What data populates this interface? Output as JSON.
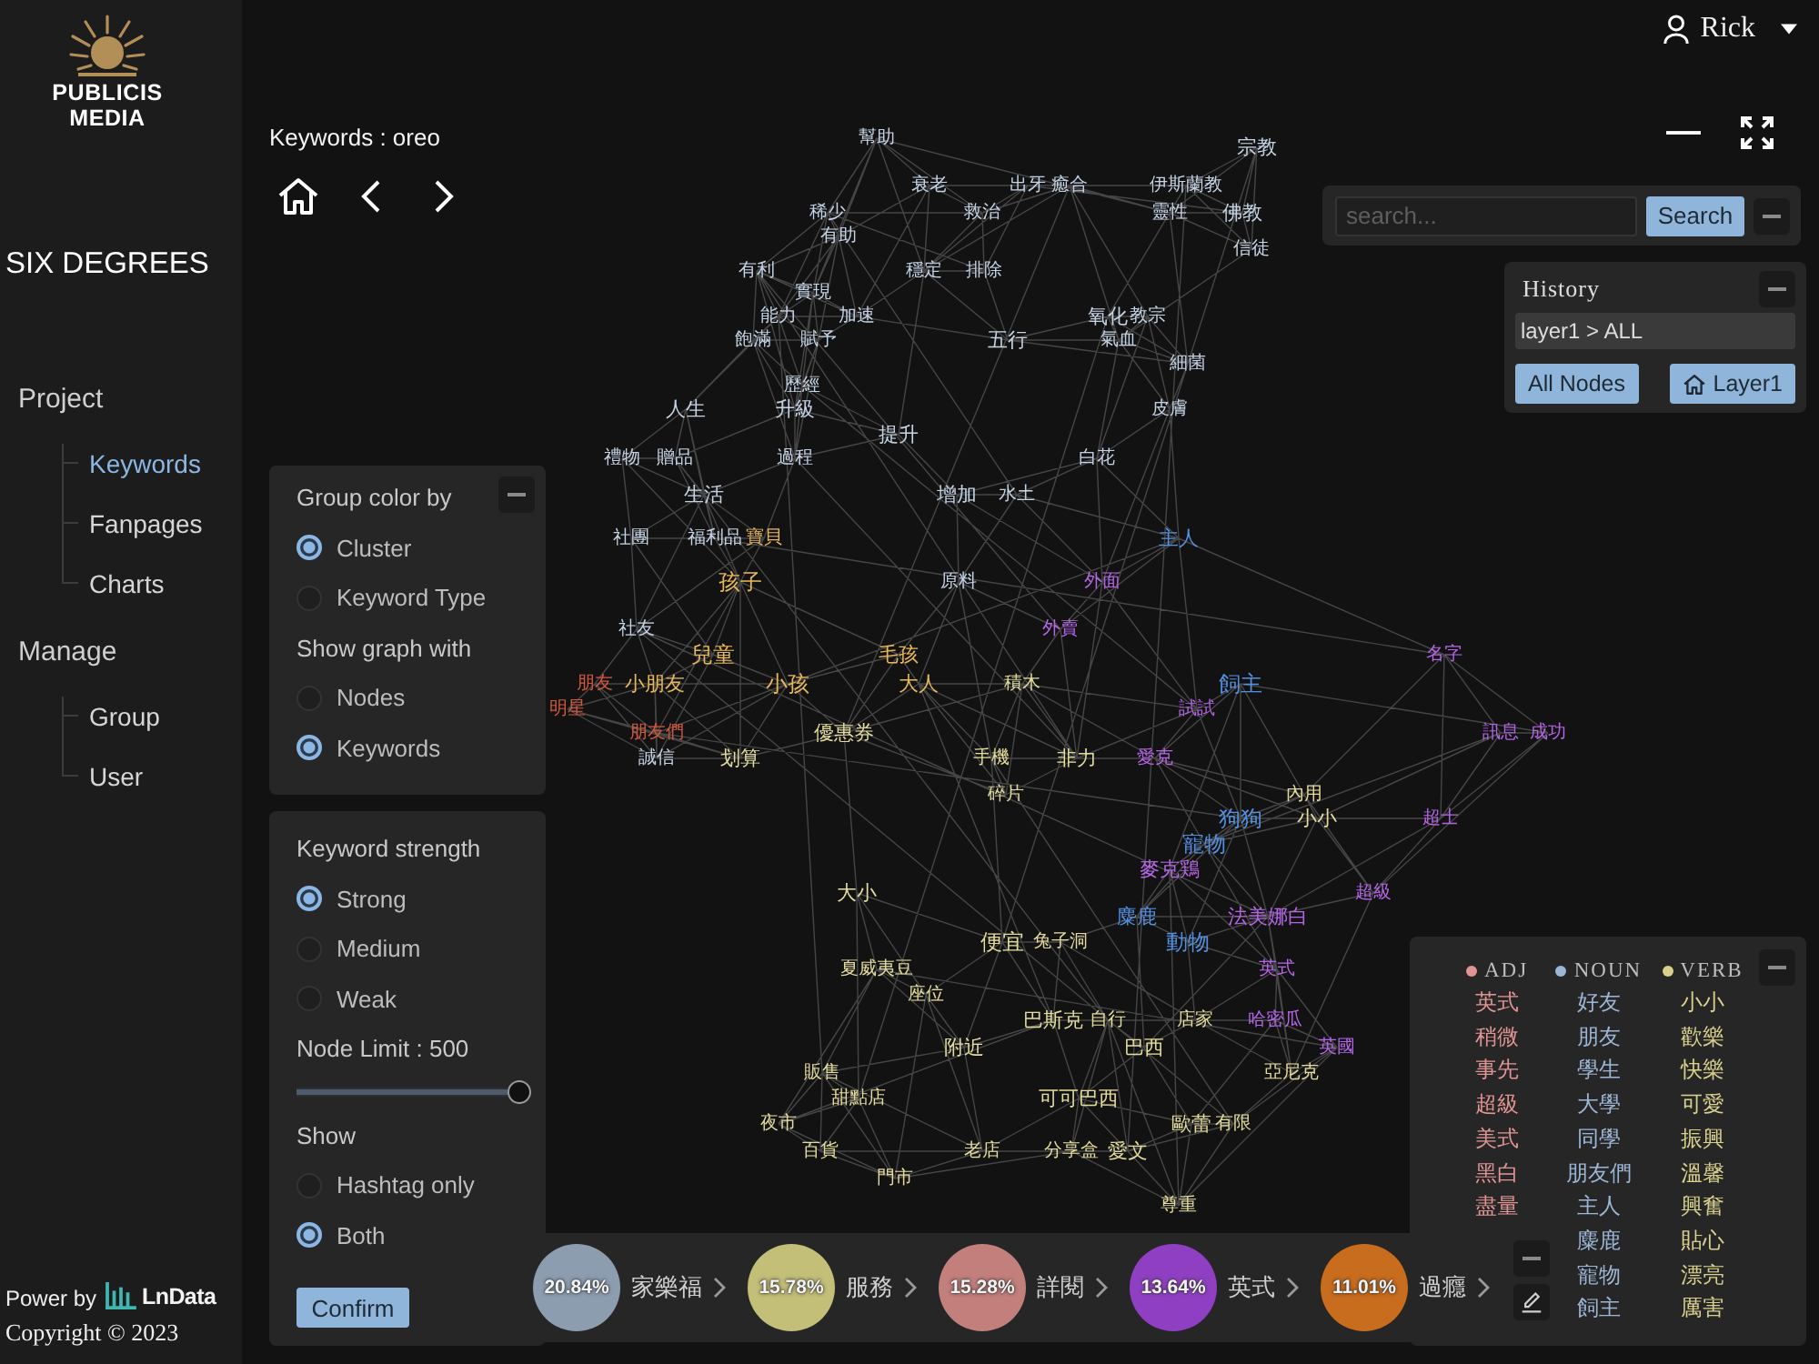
{
  "sidebar": {
    "logo_text": [
      "PUBLICIS",
      "MEDIA"
    ],
    "app_title": "SIX DEGREES",
    "sections": [
      {
        "label": "Project",
        "items": [
          {
            "label": "Keywords",
            "selected": true
          },
          {
            "label": "Fanpages",
            "selected": false
          },
          {
            "label": "Charts",
            "selected": false
          }
        ]
      },
      {
        "label": "Manage",
        "items": [
          {
            "label": "Group",
            "selected": false
          },
          {
            "label": "User",
            "selected": false
          }
        ]
      }
    ],
    "powered_by": "Power by",
    "partner_logo": "LnData",
    "copyright": "Copyright © 2023"
  },
  "header": {
    "user": "Rick"
  },
  "breadcrumb": "Keywords : oreo",
  "search": {
    "placeholder": "search...",
    "button": "Search"
  },
  "history": {
    "title": "History",
    "path": "layer1 > ALL",
    "buttons": [
      {
        "label": "All Nodes",
        "kind": "plain"
      },
      {
        "label": "Layer1",
        "kind": "home"
      }
    ]
  },
  "display_panel": {
    "groups": [
      {
        "title": "Group color by",
        "options": [
          {
            "label": "Cluster",
            "selected": true
          },
          {
            "label": "Keyword Type",
            "selected": false
          }
        ]
      },
      {
        "title": "Show graph with",
        "options": [
          {
            "label": "Nodes",
            "selected": false
          },
          {
            "label": "Keywords",
            "selected": true
          }
        ]
      }
    ]
  },
  "filter_panel": {
    "strength": {
      "title": "Keyword strength",
      "options": [
        {
          "label": "Strong",
          "selected": true
        },
        {
          "label": "Medium",
          "selected": false
        },
        {
          "label": "Weak",
          "selected": false
        }
      ]
    },
    "node_limit": {
      "label": "Node Limit : 500",
      "level": 1
    },
    "show": {
      "title": "Show",
      "options": [
        {
          "label": "Hashtag only",
          "selected": false
        },
        {
          "label": "Both",
          "selected": true
        }
      ]
    },
    "button": "Confirm"
  },
  "graph": {
    "nodes": [
      {
        "label": "幫助",
        "color": "#c4d3e4"
      },
      {
        "label": "宗教",
        "color": "#c4d3e4"
      },
      {
        "label": "衰老",
        "color": "#c4d3e4"
      },
      {
        "label": "出牙",
        "color": "#c4d3e4"
      },
      {
        "label": "癒合",
        "color": "#c4d3e4"
      },
      {
        "label": "伊斯蘭教",
        "color": "#c4d3e4"
      },
      {
        "label": "稀少",
        "color": "#c4d3e4"
      },
      {
        "label": "救治",
        "color": "#c4d3e4"
      },
      {
        "label": "靈性",
        "color": "#c4d3e4"
      },
      {
        "label": "佛教",
        "color": "#c4d3e4"
      },
      {
        "label": "有助",
        "color": "#c4d3e4"
      },
      {
        "label": "信徒",
        "color": "#c4d3e4"
      },
      {
        "label": "有利",
        "color": "#c4d3e4"
      },
      {
        "label": "穩定",
        "color": "#c4d3e4"
      },
      {
        "label": "排除",
        "color": "#c4d3e4"
      },
      {
        "label": "實現",
        "color": "#c4d3e4"
      },
      {
        "label": "能力",
        "color": "#c4d3e4"
      },
      {
        "label": "加速",
        "color": "#c4d3e4"
      },
      {
        "label": "氧化",
        "color": "#c4d3e4"
      },
      {
        "label": "教宗",
        "color": "#c4d3e4"
      },
      {
        "label": "飽滿",
        "color": "#c4d3e4"
      },
      {
        "label": "賦予",
        "color": "#c4d3e4"
      },
      {
        "label": "五行",
        "color": "#c4d3e4"
      },
      {
        "label": "氣血",
        "color": "#c4d3e4"
      },
      {
        "label": "細菌",
        "color": "#c4d3e4"
      },
      {
        "label": "歷經",
        "color": "#c4d3e4"
      },
      {
        "label": "人生",
        "color": "#c4d3e4"
      },
      {
        "label": "升級",
        "color": "#c4d3e4"
      },
      {
        "label": "皮膚",
        "color": "#c4d3e4"
      },
      {
        "label": "提升",
        "color": "#c4d3e4"
      },
      {
        "label": "禮物",
        "color": "#c4d3e4"
      },
      {
        "label": "贈品",
        "color": "#c4d3e4"
      },
      {
        "label": "過程",
        "color": "#c4d3e4"
      },
      {
        "label": "白花",
        "color": "#c4d3e4"
      },
      {
        "label": "生活",
        "color": "#c4d3e4"
      },
      {
        "label": "增加",
        "color": "#c4d3e4"
      },
      {
        "label": "水土",
        "color": "#c4d3e4"
      },
      {
        "label": "社團",
        "color": "#c4d3e4"
      },
      {
        "label": "福利品",
        "color": "#c4d3e4"
      },
      {
        "label": "寶貝",
        "color": "#e6b85a"
      },
      {
        "label": "主人",
        "color": "#5590e0"
      },
      {
        "label": "孩子",
        "color": "#e6b85a"
      },
      {
        "label": "原料",
        "color": "#c4d3e4"
      },
      {
        "label": "外面",
        "color": "#b466e6"
      },
      {
        "label": "社友",
        "color": "#c4d3e4"
      },
      {
        "label": "外賣",
        "color": "#b466e6"
      },
      {
        "label": "兒童",
        "color": "#e6b85a"
      },
      {
        "label": "毛孩",
        "color": "#e6b85a"
      },
      {
        "label": "名字",
        "color": "#b466e6"
      },
      {
        "label": "朋友",
        "color": "#d2583f"
      },
      {
        "label": "小朋友",
        "color": "#e6b85a"
      },
      {
        "label": "小孩",
        "color": "#e6b85a"
      },
      {
        "label": "大人",
        "color": "#e6b85a"
      },
      {
        "label": "積木",
        "color": "#e3dc9c"
      },
      {
        "label": "飼主",
        "color": "#5590e0"
      },
      {
        "label": "明星",
        "color": "#d2583f"
      },
      {
        "label": "試試",
        "color": "#b466e6"
      },
      {
        "label": "朋友們",
        "color": "#d2583f"
      },
      {
        "label": "優惠券",
        "color": "#e3dc9c"
      },
      {
        "label": "訊息",
        "color": "#b466e6"
      },
      {
        "label": "成功",
        "color": "#b466e6"
      },
      {
        "label": "誠信",
        "color": "#c4d3e4"
      },
      {
        "label": "划算",
        "color": "#e3dc9c"
      },
      {
        "label": "手機",
        "color": "#e3dc9c"
      },
      {
        "label": "非力",
        "color": "#e3dc9c"
      },
      {
        "label": "愛克",
        "color": "#b466e6"
      },
      {
        "label": "碎片",
        "color": "#e3dc9c"
      },
      {
        "label": "內用",
        "color": "#e3dc9c"
      },
      {
        "label": "狗狗",
        "color": "#5590e0"
      },
      {
        "label": "小小",
        "color": "#e3dc9c"
      },
      {
        "label": "超士",
        "color": "#b466e6"
      },
      {
        "label": "寵物",
        "color": "#5590e0"
      },
      {
        "label": "麥克鶏",
        "color": "#b466e6"
      },
      {
        "label": "大小",
        "color": "#e3dc9c"
      },
      {
        "label": "超級",
        "color": "#b466e6"
      },
      {
        "label": "麋鹿",
        "color": "#5590e0"
      },
      {
        "label": "法美娜白",
        "color": "#b466e6"
      },
      {
        "label": "便宜",
        "color": "#e3dc9c"
      },
      {
        "label": "兔子洞",
        "color": "#e3dc9c"
      },
      {
        "label": "動物",
        "color": "#5590e0"
      },
      {
        "label": "夏威夷豆",
        "color": "#e3dc9c"
      },
      {
        "label": "英式",
        "color": "#b466e6"
      },
      {
        "label": "座位",
        "color": "#e3dc9c"
      },
      {
        "label": "巴斯克",
        "color": "#e3dc9c"
      },
      {
        "label": "自行",
        "color": "#e3dc9c"
      },
      {
        "label": "店家",
        "color": "#e3dc9c"
      },
      {
        "label": "哈密瓜",
        "color": "#b466e6"
      },
      {
        "label": "附近",
        "color": "#e3dc9c"
      },
      {
        "label": "巴西",
        "color": "#e3dc9c"
      },
      {
        "label": "英國",
        "color": "#b466e6"
      },
      {
        "label": "販售",
        "color": "#e3dc9c"
      },
      {
        "label": "亞尼克",
        "color": "#e3dc9c"
      },
      {
        "label": "甜點店",
        "color": "#e3dc9c"
      },
      {
        "label": "可可巴西",
        "color": "#e3dc9c"
      },
      {
        "label": "夜市",
        "color": "#e3dc9c"
      },
      {
        "label": "歐蕾",
        "color": "#e3dc9c"
      },
      {
        "label": "有限",
        "color": "#e3dc9c"
      },
      {
        "label": "百貨",
        "color": "#e3dc9c"
      },
      {
        "label": "老店",
        "color": "#e3dc9c"
      },
      {
        "label": "分享盒",
        "color": "#e3dc9c"
      },
      {
        "label": "愛文",
        "color": "#e3dc9c"
      },
      {
        "label": "門市",
        "color": "#e3dc9c"
      },
      {
        "label": "尊重",
        "color": "#e3dc9c"
      }
    ]
  },
  "legend": {
    "columns": [
      {
        "title": "ADJ",
        "color": "#e09494",
        "words": [
          "英式",
          "稍微",
          "事先",
          "超級",
          "美式",
          "黑白",
          "盡量"
        ]
      },
      {
        "title": "NOUN",
        "color": "#9db6d6",
        "words": [
          "好友",
          "朋友",
          "學生",
          "大學",
          "同學",
          "朋友們",
          "主人",
          "麋鹿",
          "寵物",
          "飼主"
        ]
      },
      {
        "title": "VERB",
        "color": "#d8d08c",
        "words": [
          "小小",
          "歡樂",
          "快樂",
          "可愛",
          "振興",
          "溫馨",
          "興奮",
          "貼心",
          "漂亮",
          "厲害"
        ]
      }
    ]
  },
  "clusters": [
    {
      "share": "20.84%",
      "label": "家樂福",
      "color": "#8d9db0"
    },
    {
      "share": "15.78%",
      "label": "服務",
      "color": "#c3be78"
    },
    {
      "share": "15.28%",
      "label": "詳閱",
      "color": "#c27f7c"
    },
    {
      "share": "13.64%",
      "label": "英式",
      "color": "#8f40c2"
    },
    {
      "share": "11.01%",
      "label": "過癮",
      "color": "#c86c1e"
    }
  ]
}
